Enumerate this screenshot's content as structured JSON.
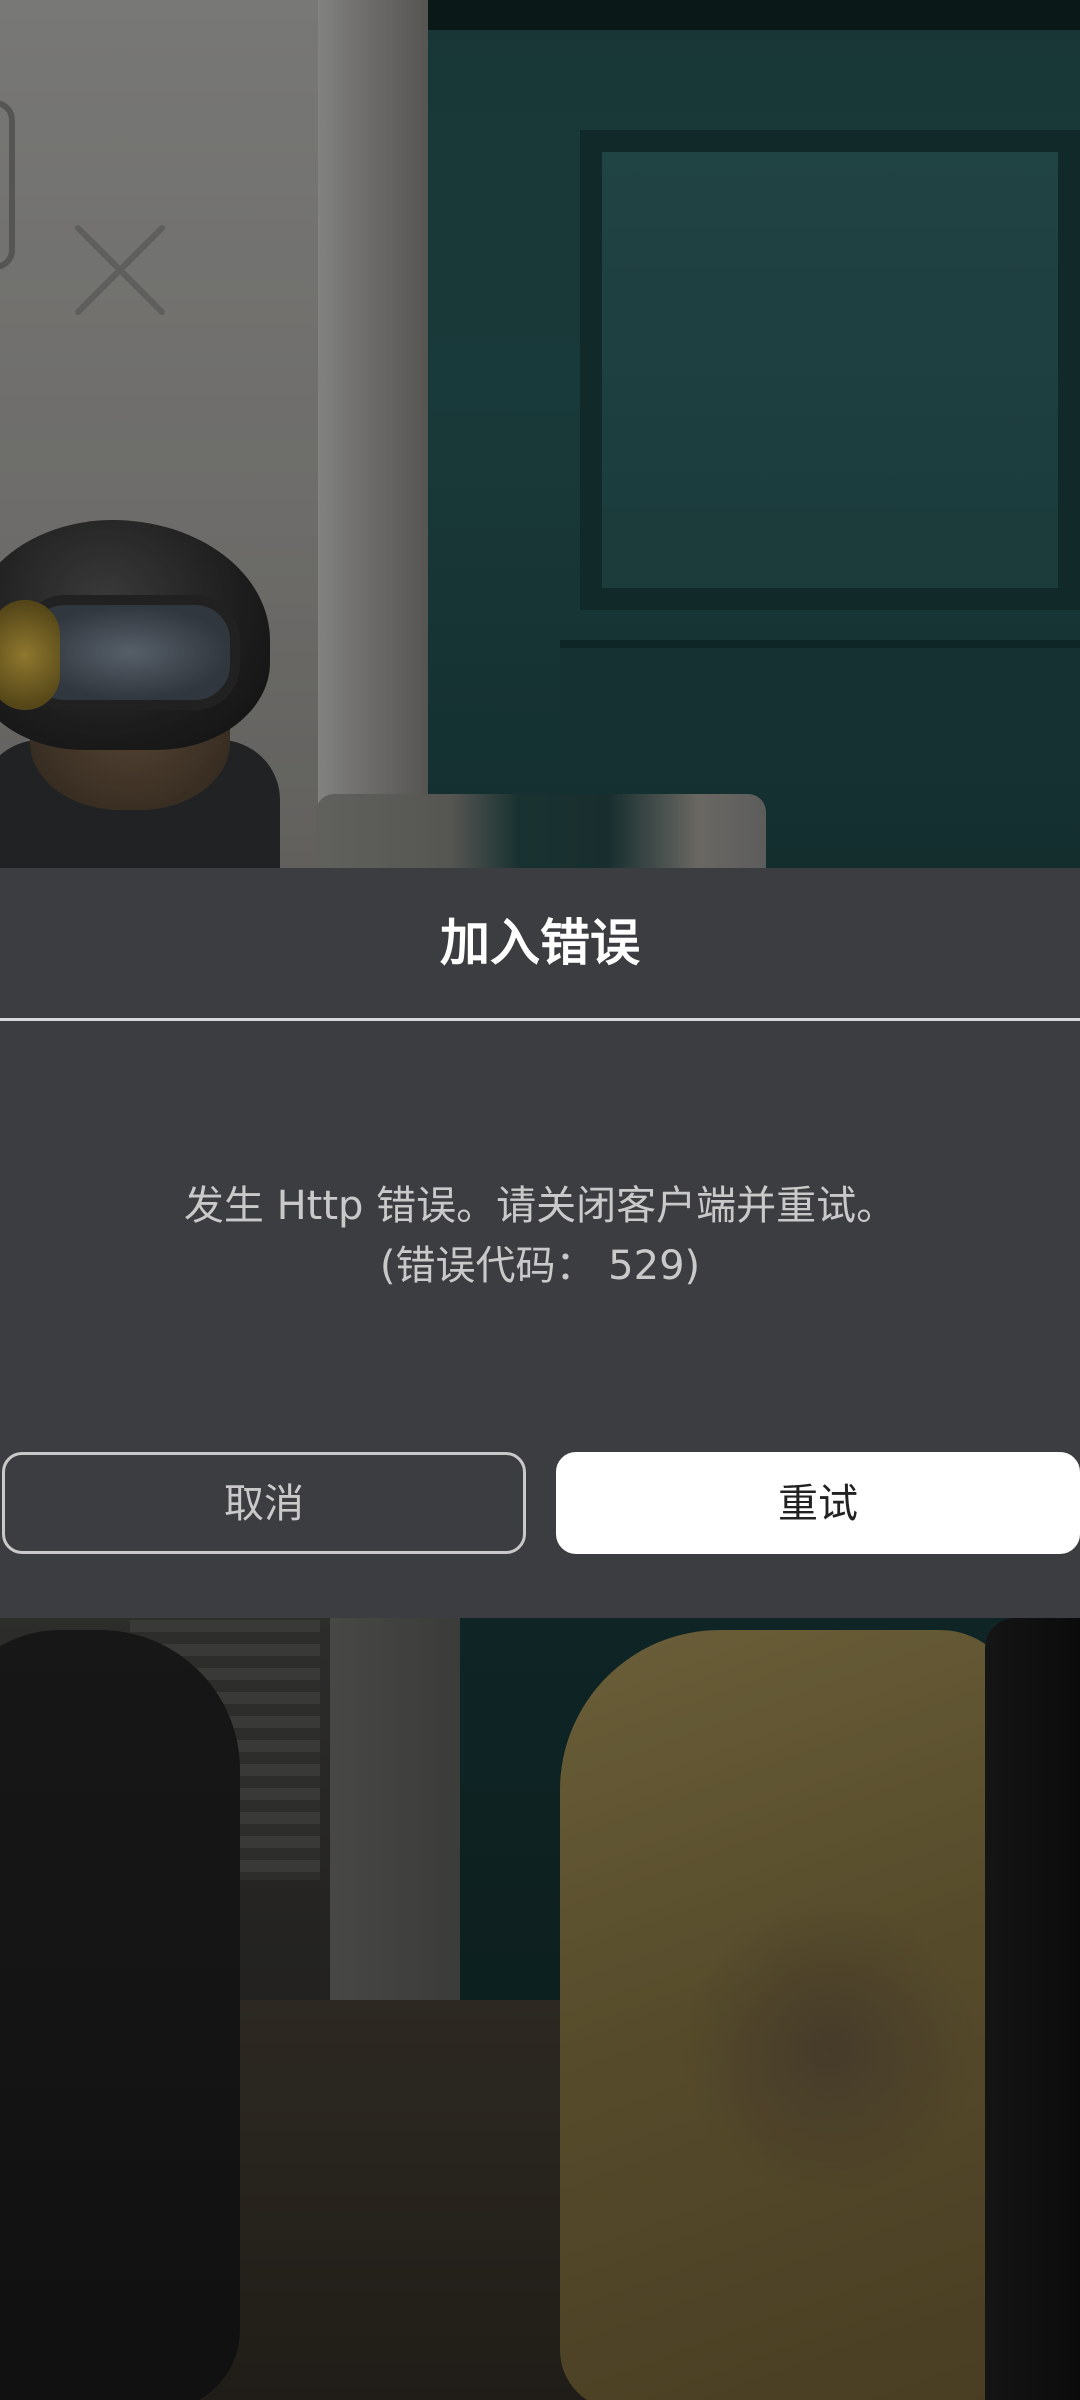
{
  "dialog": {
    "title": "加入错误",
    "message_line1": "发生 Http 错误。请关闭客户端并重试。",
    "message_line2": "(错误代码： 529)",
    "cancel_label": "取消",
    "retry_label": "重试"
  },
  "icons": {
    "close": "close-icon"
  },
  "colors": {
    "dialog_background": "#3c3d40",
    "title_text": "#ffffff",
    "message_text": "#c9c9c9",
    "retry_button_background": "#ffffff",
    "retry_button_text": "#222222"
  }
}
